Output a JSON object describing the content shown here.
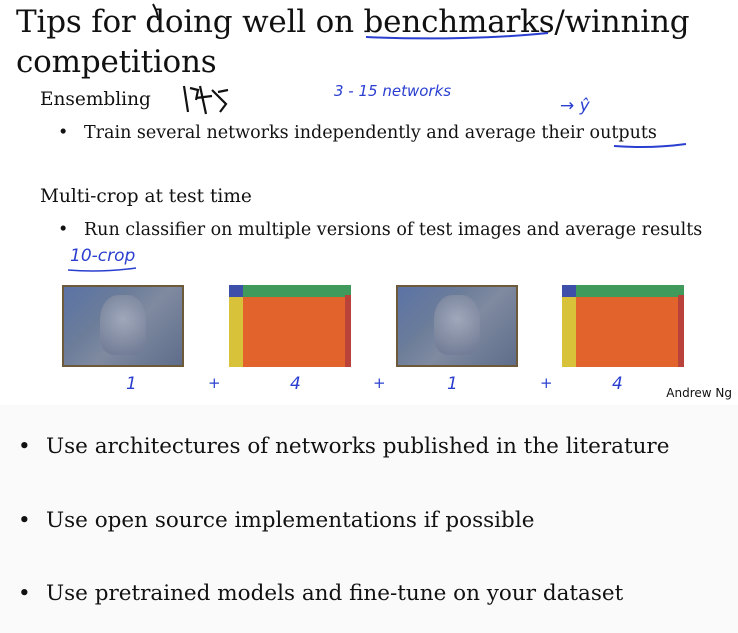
{
  "slide": {
    "title": "Tips for doing well on benchmarks/winning competitions",
    "ensembling": {
      "heading": "Ensembling",
      "bullet": "Train several networks independently and average their outputs"
    },
    "multicrop": {
      "heading": "Multi-crop at test time",
      "bullet": "Run classifier on multiple versions of test images and average results"
    },
    "credit": "Andrew Ng"
  },
  "annotations": {
    "networks_note": "3 - 15   networks",
    "yhat_note": "→ ŷ",
    "tencrop_note": "10-crop",
    "crop_counts": [
      "1",
      "+",
      "4",
      "+",
      "1",
      "+",
      "4"
    ]
  },
  "bullets": [
    "Use architectures of networks published in the literature",
    "Use open source implementations if possible",
    "Use pretrained models and fine-tune on your dataset"
  ],
  "colors": {
    "handwriting": "#2a3fd0",
    "text": "#111111"
  },
  "icons": {
    "bullet": "•"
  }
}
